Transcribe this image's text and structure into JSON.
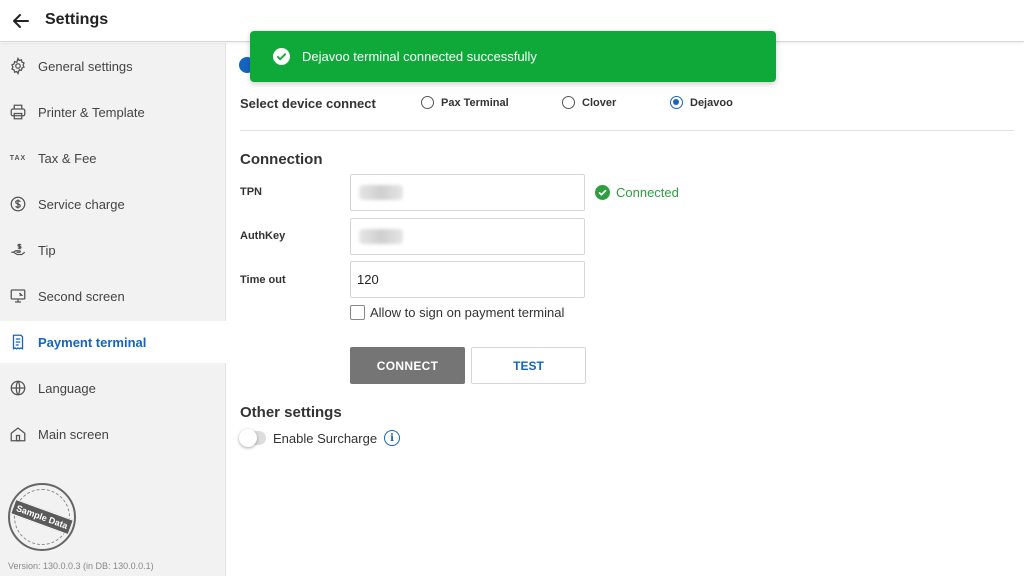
{
  "header": {
    "title": "Settings"
  },
  "sidebar": {
    "items": [
      {
        "label": "General settings",
        "icon": "gear-icon"
      },
      {
        "label": "Printer & Template",
        "icon": "printer-icon"
      },
      {
        "label": "Tax & Fee",
        "icon": "tax-icon",
        "icon_text": "TAX"
      },
      {
        "label": "Service charge",
        "icon": "dollar-circle-icon"
      },
      {
        "label": "Tip",
        "icon": "hand-coin-icon"
      },
      {
        "label": "Second screen",
        "icon": "monitor-icon"
      },
      {
        "label": "Payment terminal",
        "icon": "receipt-icon",
        "active": true
      },
      {
        "label": "Language",
        "icon": "globe-icon"
      },
      {
        "label": "Main screen",
        "icon": "home-icon"
      }
    ],
    "stamp_text": "Sample Data",
    "version": "Version:  130.0.0.3  (in DB: 130.0.0.1)"
  },
  "toast": {
    "message": "Dejavoo terminal connected successfully",
    "color": "#0fa93a"
  },
  "device": {
    "label": "Select device connect",
    "options": [
      "Pax Terminal",
      "Clover",
      "Dejavoo"
    ],
    "selected": "Dejavoo"
  },
  "connection": {
    "title": "Connection",
    "tpn_label": "TPN",
    "authkey_label": "AuthKey",
    "timeout_label": "Time out",
    "timeout_value": "120",
    "status": "Connected",
    "allow_sign_label": "Allow to sign on payment terminal",
    "allow_sign_checked": false,
    "connect_label": "CONNECT",
    "test_label": "TEST"
  },
  "other": {
    "title": "Other settings",
    "surcharge_label": "Enable Surcharge",
    "surcharge_enabled": false
  },
  "colors": {
    "accent": "#1565c0",
    "success": "#2e9f40",
    "connect_button": "#757575"
  }
}
